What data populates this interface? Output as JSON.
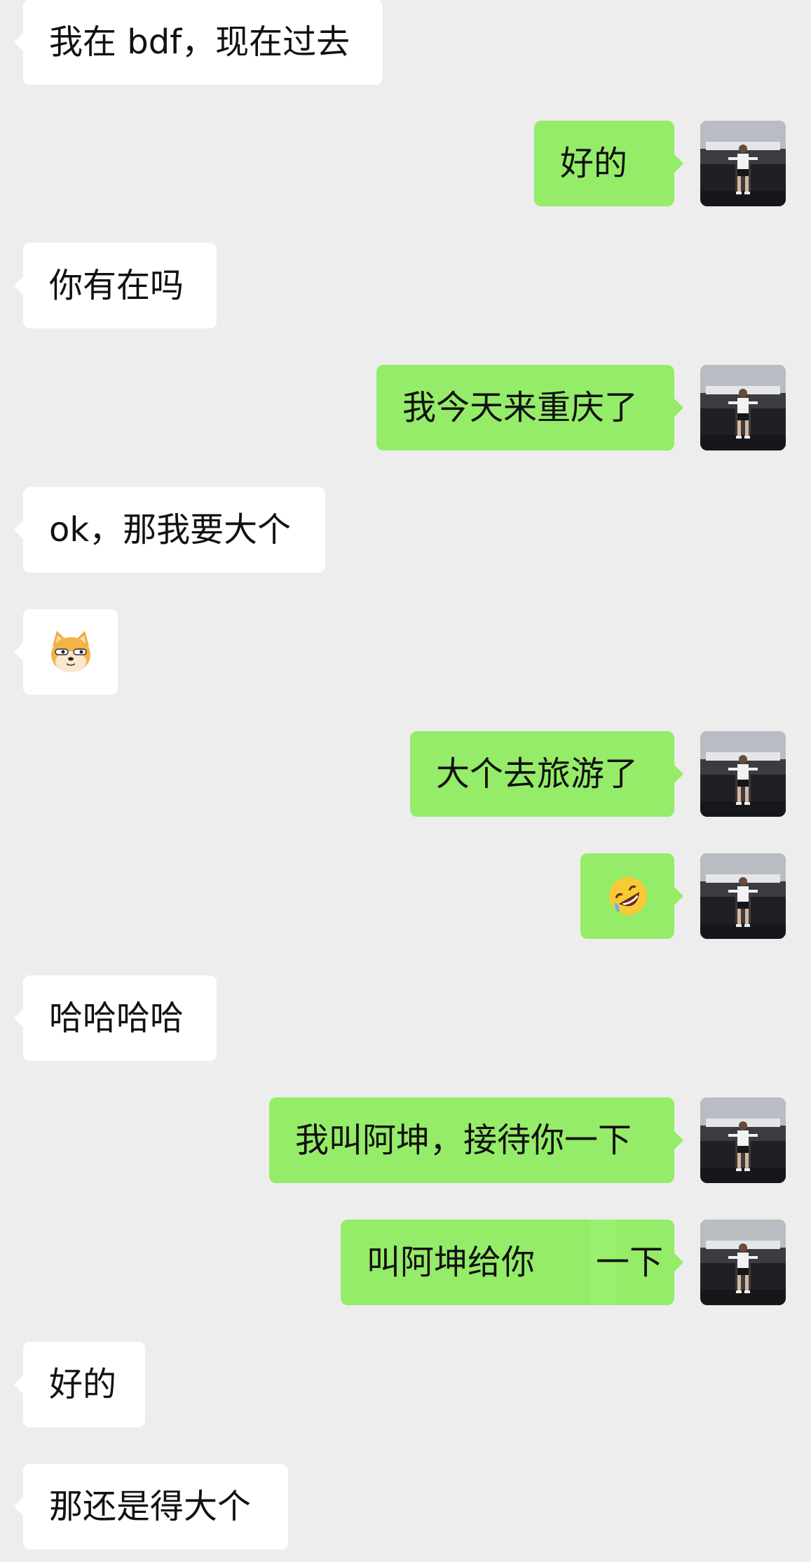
{
  "messages": [
    {
      "side": "in",
      "text": "我在 bdf，现在过去"
    },
    {
      "side": "out",
      "text": "好的"
    },
    {
      "side": "in",
      "text": "你有在吗"
    },
    {
      "side": "out",
      "text": "我今天来重庆了"
    },
    {
      "side": "in",
      "text": "ok，那我要大个"
    },
    {
      "side": "in",
      "sticker": "doge-cat-face-emoji"
    },
    {
      "side": "out",
      "text": "大个去旅游了"
    },
    {
      "side": "out",
      "sticker": "rolling-on-floor-laughing-emoji"
    },
    {
      "side": "in",
      "text": "哈哈哈哈"
    },
    {
      "side": "out",
      "text": "我叫阿坤，接待你一下"
    },
    {
      "side": "out",
      "text": "叫阿坤给你",
      "text_after_gap": "一下"
    },
    {
      "side": "in",
      "text": "好的"
    },
    {
      "side": "in",
      "text": "那还是得大个"
    }
  ],
  "colors": {
    "background": "#ededed",
    "incoming_bubble": "#ffffff",
    "outgoing_bubble": "#95ec69",
    "text": "#111111"
  }
}
